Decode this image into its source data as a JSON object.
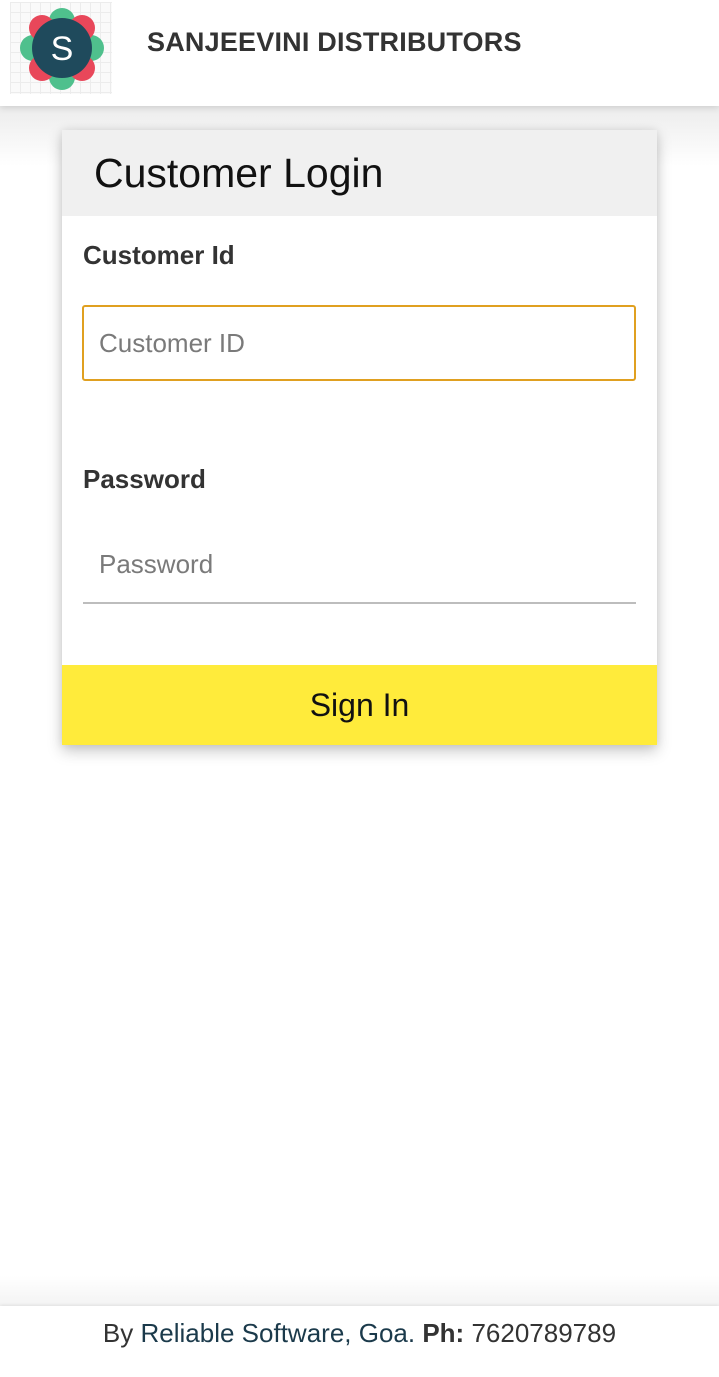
{
  "header": {
    "logo_letter": "S",
    "company_name": "SANJEEVINI DISTRIBUTORS"
  },
  "login_card": {
    "title": "Customer Login",
    "customer_id_label": "Customer Id",
    "customer_id_placeholder": "Customer ID",
    "customer_id_value": "",
    "password_label": "Password",
    "password_placeholder": "Password",
    "password_value": "",
    "signin_label": "Sign In"
  },
  "footer": {
    "prefix": "By",
    "company_link": "Reliable Software, Goa.",
    "phone_label": "Ph:",
    "phone_number": "7620789789"
  },
  "colors": {
    "accent_yellow": "#ffeb3b",
    "focus_border": "#e0a020",
    "logo_dark": "#1f4a5c",
    "logo_red": "#e8475a",
    "logo_green": "#4fc08d"
  },
  "icons": [
    "sanjeevini-logo-icon"
  ]
}
